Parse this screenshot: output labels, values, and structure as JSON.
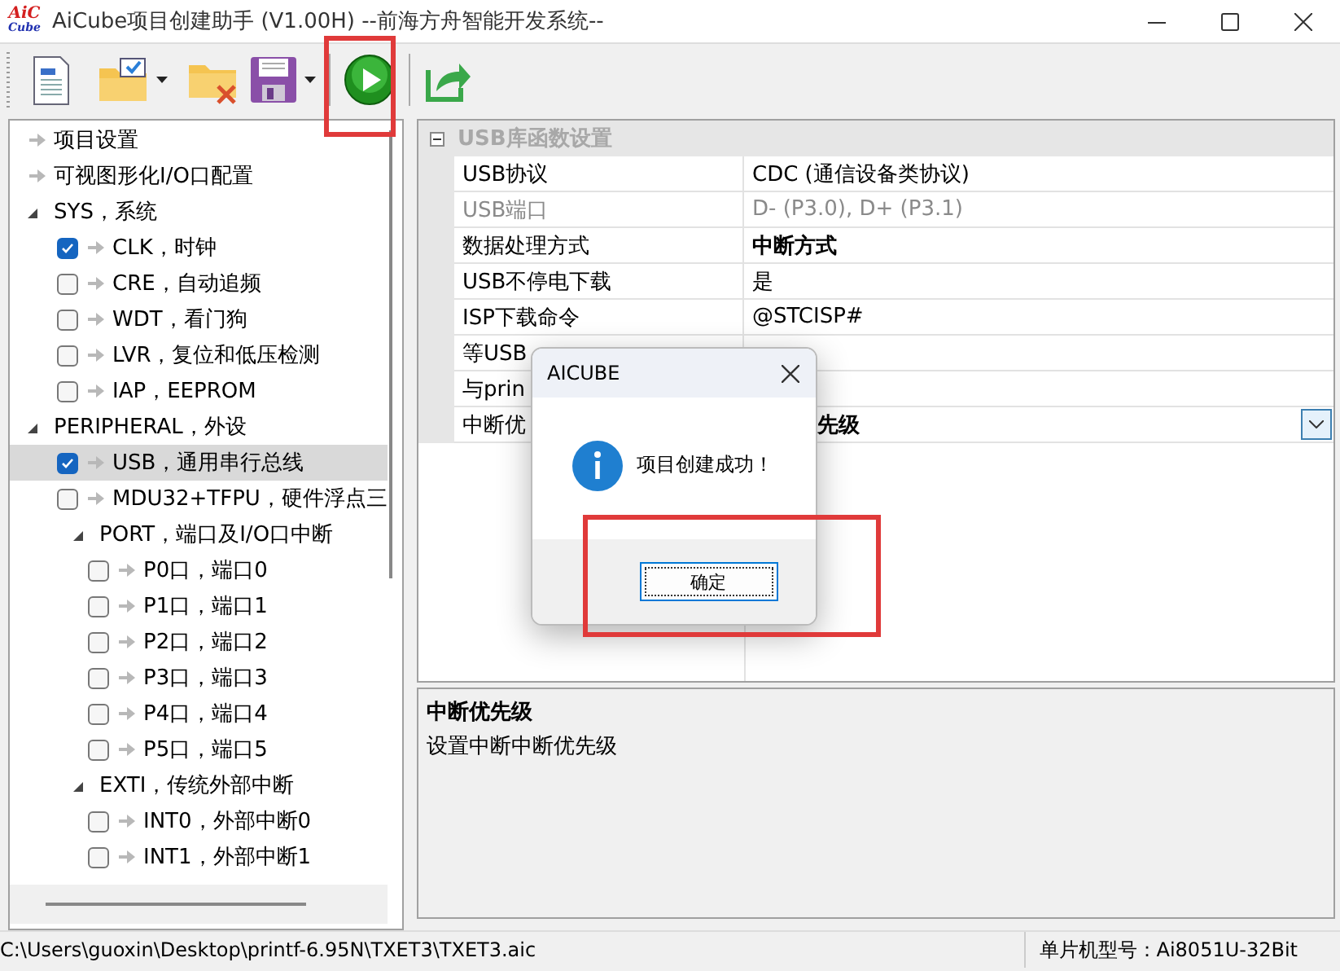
{
  "window": {
    "logo": [
      "AiC",
      "Cube"
    ],
    "title": "AiCube项目创建助手 (V1.00H) --前海方舟智能开发系统--"
  },
  "tree": {
    "items": [
      {
        "kind": "leaf",
        "label": "项目设置",
        "selected": false
      },
      {
        "kind": "leaf",
        "label": "可视图形化I/O口配置",
        "selected": false
      },
      {
        "kind": "group",
        "label": "SYS，系统",
        "expanded": true,
        "selected": false,
        "children": [
          {
            "kind": "check",
            "label": "CLK，时钟",
            "checked": true,
            "selected": false
          },
          {
            "kind": "check",
            "label": "CRE，自动追频",
            "checked": false,
            "selected": false
          },
          {
            "kind": "check",
            "label": "WDT，看门狗",
            "checked": false,
            "selected": false
          },
          {
            "kind": "check",
            "label": "LVR，复位和低压检测",
            "checked": false,
            "selected": false
          },
          {
            "kind": "check",
            "label": "IAP，EEPROM",
            "checked": false,
            "selected": false
          }
        ]
      },
      {
        "kind": "group",
        "label": "PERIPHERAL，外设",
        "expanded": true,
        "selected": false,
        "children": [
          {
            "kind": "check",
            "label": "USB，通用串行总线",
            "checked": true,
            "selected": true
          },
          {
            "kind": "check",
            "label": "MDU32+TFPU，硬件浮点三",
            "checked": false,
            "selected": false
          },
          {
            "kind": "group",
            "label": "PORT，端口及I/O口中断",
            "expanded": true,
            "selected": false,
            "children": [
              {
                "kind": "check",
                "label": "P0口，端口0",
                "checked": false,
                "selected": false
              },
              {
                "kind": "check",
                "label": "P1口，端口1",
                "checked": false,
                "selected": false
              },
              {
                "kind": "check",
                "label": "P2口，端口2",
                "checked": false,
                "selected": false
              },
              {
                "kind": "check",
                "label": "P3口，端口3",
                "checked": false,
                "selected": false
              },
              {
                "kind": "check",
                "label": "P4口，端口4",
                "checked": false,
                "selected": false
              },
              {
                "kind": "check",
                "label": "P5口，端口5",
                "checked": false,
                "selected": false
              }
            ]
          },
          {
            "kind": "group",
            "label": "EXTI，传统外部中断",
            "expanded": true,
            "selected": false,
            "children": [
              {
                "kind": "check",
                "label": "INT0，外部中断0",
                "checked": false,
                "selected": false
              },
              {
                "kind": "check",
                "label": "INT1，外部中断1",
                "checked": false,
                "selected": false
              }
            ]
          }
        ]
      }
    ]
  },
  "properties": {
    "category": "USB库函数设置",
    "expanded": true,
    "rows": [
      {
        "name": "USB协议",
        "value": "CDC (通信设备类协议)",
        "disabled": false,
        "modified": false,
        "selected": false
      },
      {
        "name": "USB端口",
        "value": "D- (P3.0), D+ (P3.1)",
        "disabled": true,
        "modified": false,
        "selected": false
      },
      {
        "name": "数据处理方式",
        "value": "中断方式",
        "disabled": false,
        "modified": true,
        "selected": false
      },
      {
        "name": "USB不停电下载",
        "value": "是",
        "disabled": false,
        "modified": false,
        "selected": false
      },
      {
        "name": "ISP下载命令",
        "value": "@STCISP#",
        "disabled": false,
        "modified": false,
        "selected": false
      },
      {
        "name": "等USB",
        "disabled": false,
        "selected": false
      },
      {
        "name": "与prin",
        "disabled": false,
        "selected": false
      },
      {
        "name": "中断优",
        "value": "先级",
        "disabled": false,
        "modified": true,
        "selected": true
      }
    ]
  },
  "description": {
    "title": "中断优先级",
    "text": "设置中断中断优先级"
  },
  "dialog": {
    "title": "AICUBE",
    "message": "项目创建成功！",
    "button": "确定"
  },
  "status_bar": {
    "path": "C:\\Users\\guoxin\\Desktop\\printf-6.95N\\TXET3\\TXET3.aic",
    "chip": "单片机型号：Ai8051U-32Bit"
  }
}
